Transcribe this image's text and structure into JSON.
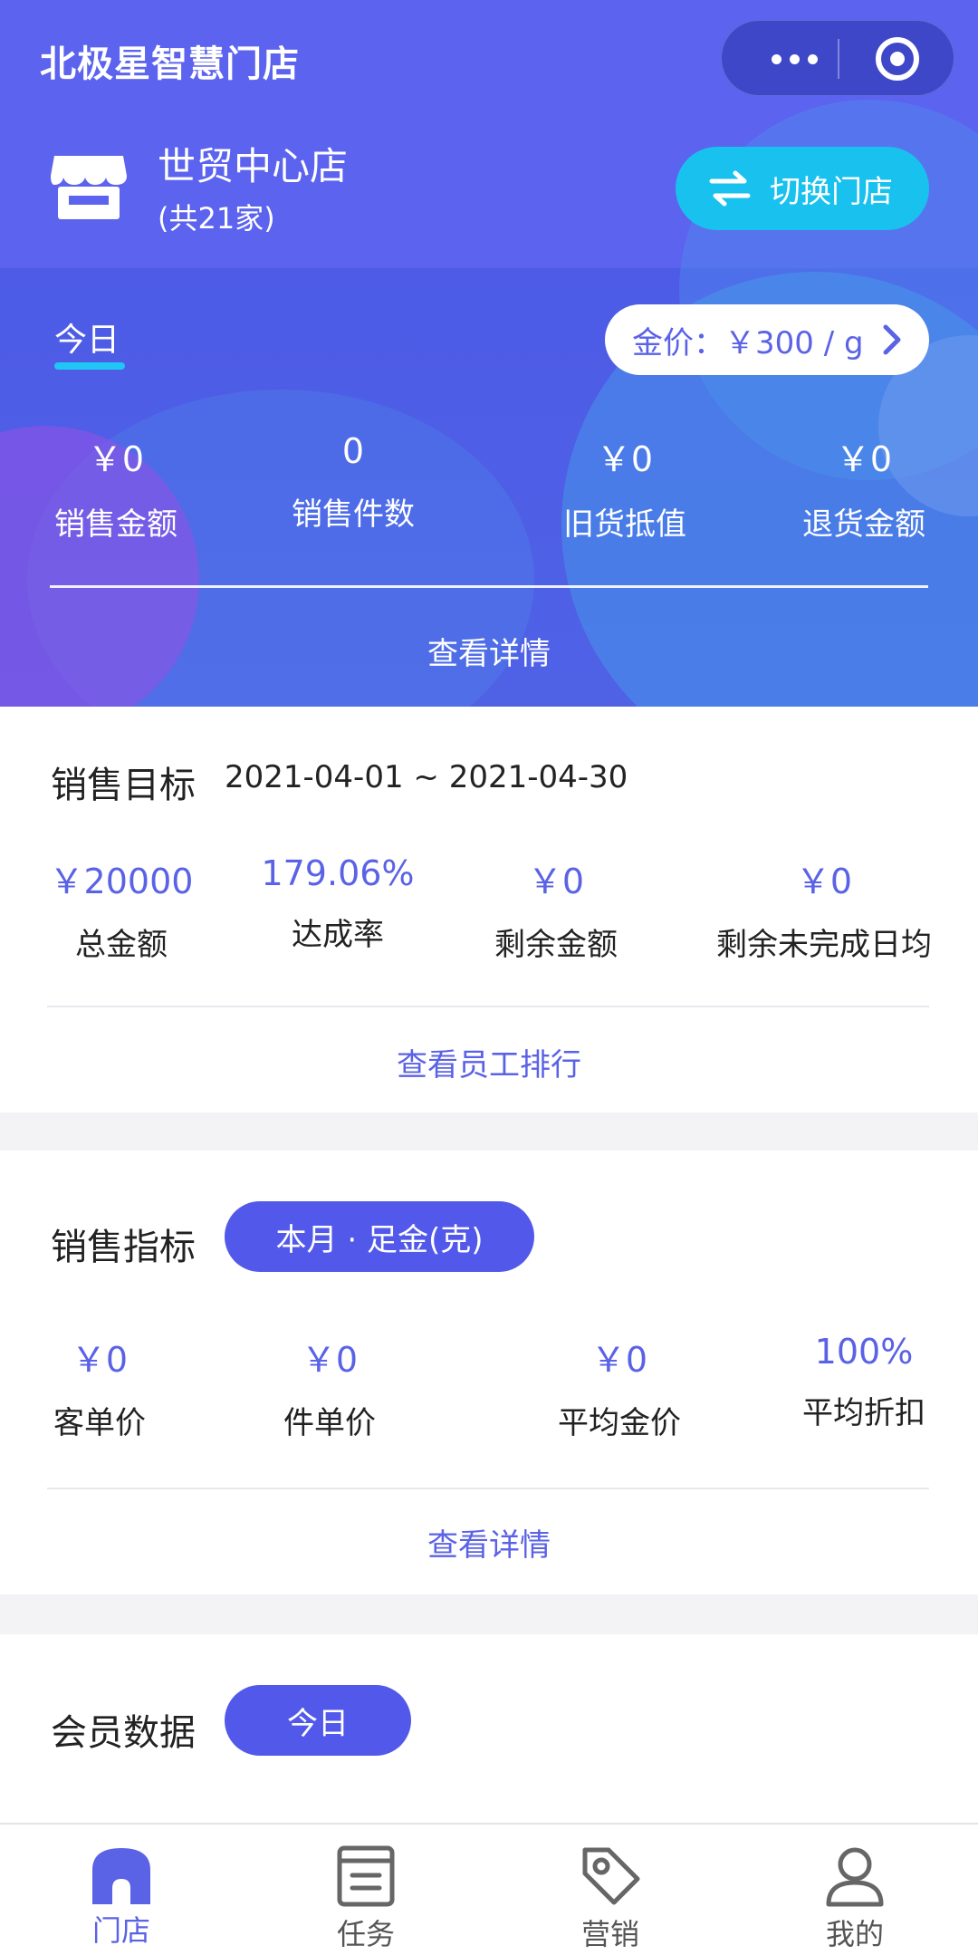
{
  "header": {
    "app_title": "北极星智慧门店",
    "store_name": "世贸中心店",
    "store_count": "(共21家)",
    "switch_label": "切换门店"
  },
  "today_panel": {
    "tab_label": "今日",
    "gold_price": "金价：￥300 / g",
    "stats": [
      {
        "value": "￥0",
        "label": "销售金额"
      },
      {
        "value": "0",
        "label": "销售件数"
      },
      {
        "value": "￥0",
        "label": "旧货抵值"
      },
      {
        "value": "￥0",
        "label": "退货金额"
      }
    ],
    "detail_link": "查看详情"
  },
  "sales_target": {
    "title": "销售目标",
    "date_range": "2021-04-01 ~ 2021-04-30",
    "metrics": [
      {
        "value": "￥20000",
        "label": "总金额"
      },
      {
        "value": "179.06%",
        "label": "达成率"
      },
      {
        "value": "￥0",
        "label": "剩余金额"
      },
      {
        "value": "￥0",
        "label": "剩余未完成日均"
      }
    ],
    "link": "查看员工排行"
  },
  "sales_index": {
    "title": "销售指标",
    "filter": "本月 · 足金(克)",
    "metrics": [
      {
        "value": "￥0",
        "label": "客单价"
      },
      {
        "value": "￥0",
        "label": "件单价"
      },
      {
        "value": "￥0",
        "label": "平均金价"
      },
      {
        "value": "100%",
        "label": "平均折扣"
      }
    ],
    "link": "查看详情"
  },
  "member_data": {
    "title": "会员数据",
    "filter": "今日"
  },
  "tabbar": {
    "items": [
      {
        "label": "门店",
        "icon": "store-icon",
        "active": true
      },
      {
        "label": "任务",
        "icon": "task-icon",
        "active": false
      },
      {
        "label": "营销",
        "icon": "tag-icon",
        "active": false
      },
      {
        "label": "我的",
        "icon": "user-icon",
        "active": false
      }
    ]
  },
  "colors": {
    "hero_bg": "#5b63ef",
    "accent": "#5a62e6",
    "switch_button": "#19c1ef",
    "tab_underline": "#22c6f4"
  }
}
